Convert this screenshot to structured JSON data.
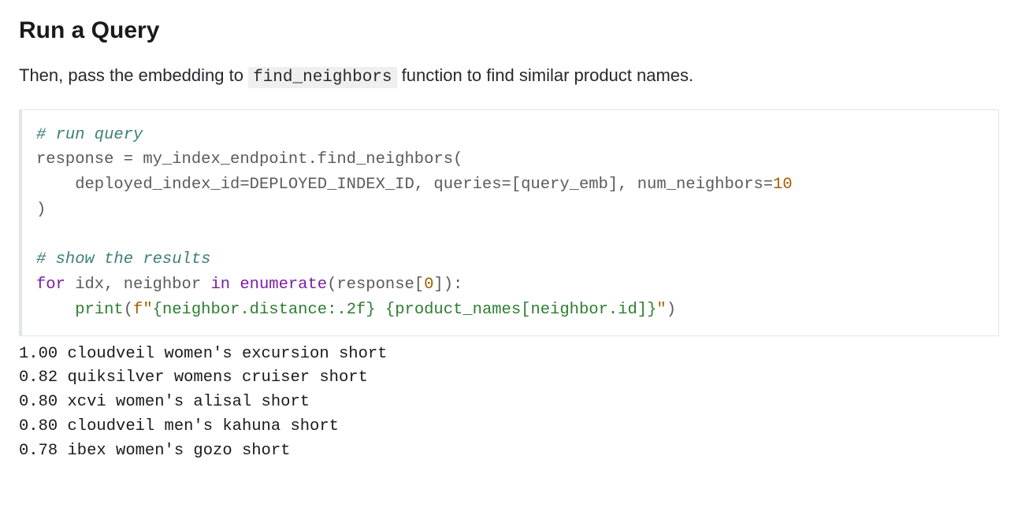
{
  "heading": "Run a Query",
  "description": {
    "pre": "Then, pass the embedding to ",
    "code": "find_neighbors",
    "post": " function to find similar product names."
  },
  "code": {
    "c1": "# run query",
    "l1a": "response ",
    "l1b": "=",
    "l1c": " my_index_endpoint",
    "l1d": ".",
    "l1e": "find_neighbors(",
    "l2a": "    deployed_index_id",
    "l2b": "=",
    "l2c": "DEPLOYED_INDEX_ID, queries",
    "l2d": "=",
    "l2e": "[query_emb], num_neighbors",
    "l2f": "=",
    "l2g": "10",
    "l3": ")",
    "c2": "# show the results",
    "l4a": "for",
    "l4b": " idx, neighbor ",
    "l4c": "in",
    "l4d": " ",
    "l4e": "enumerate",
    "l4f": "(response[",
    "l4g": "0",
    "l4h": "]):",
    "l5a": "    ",
    "l5b": "print",
    "l5c": "(",
    "l5d": "f\"",
    "l5e": "{neighbor.distance:.2f}",
    "l5f": " ",
    "l5g": "{product_names[neighbor.id]}",
    "l5h": "\"",
    "l5i": ")"
  },
  "output_lines": [
    "1.00 cloudveil women's excursion short",
    "0.82 quiksilver womens cruiser short",
    "0.80 xcvi women's alisal short",
    "0.80 cloudveil men's kahuna short",
    "0.78 ibex women's gozo short"
  ]
}
